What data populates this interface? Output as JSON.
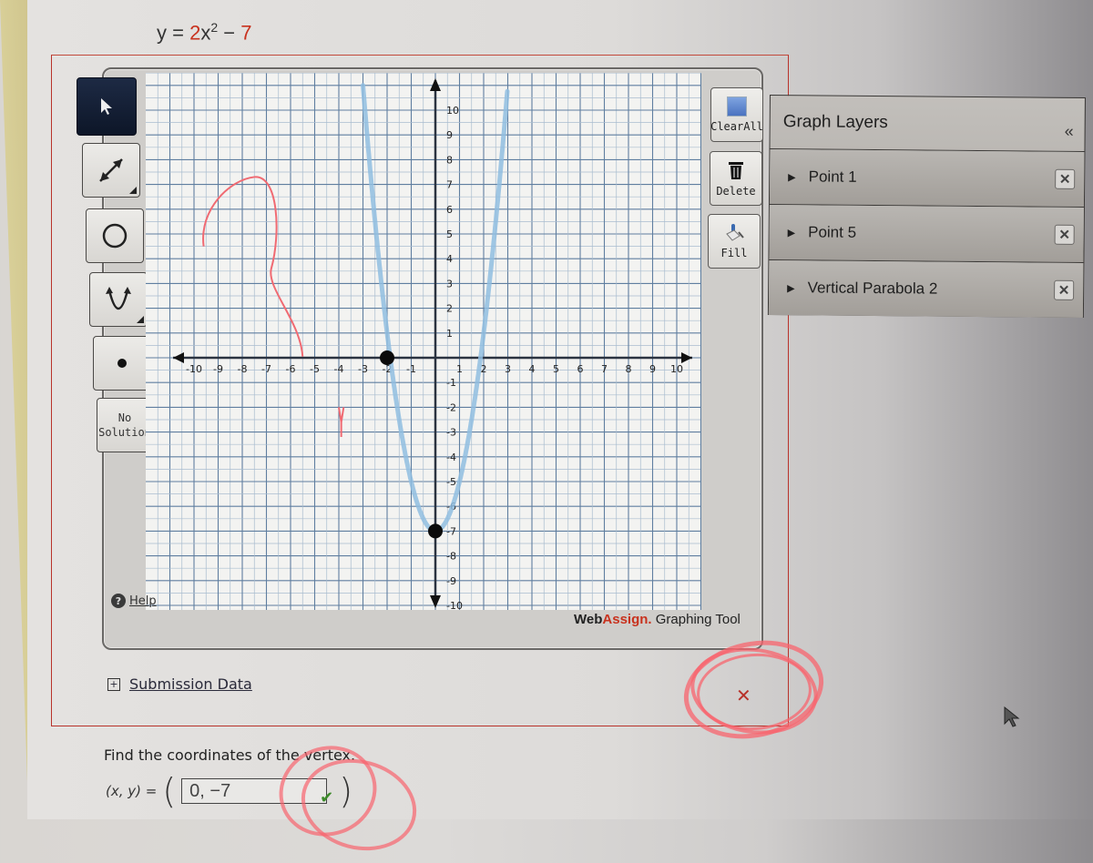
{
  "problem": {
    "equation_prefix": "y = ",
    "coefficient_a": "2",
    "variable": "x",
    "exponent": "2",
    "operator": " − ",
    "constant": "7"
  },
  "toolbar_left": [
    {
      "name": "select-tool",
      "icon": "arrow-pointer-icon",
      "selected": true
    },
    {
      "name": "line-tool",
      "icon": "double-arrow-line-icon",
      "has_submenu": true
    },
    {
      "name": "circle-tool",
      "icon": "circle-icon"
    },
    {
      "name": "parabola-tool",
      "icon": "parabola-icon",
      "has_submenu": true
    },
    {
      "name": "point-tool",
      "icon": "point-icon"
    },
    {
      "name": "no-solution-button",
      "label": "No\nSolution"
    }
  ],
  "toolbar_right": {
    "clear_all_label": "ClearAll",
    "delete_label": "Delete",
    "fill_label": "Fill"
  },
  "help_label": "Help",
  "branding": {
    "web": "Web",
    "assign": "Assign.",
    "suffix": " Graphing Tool"
  },
  "graph_layers": {
    "title": "Graph Layers",
    "collapse_icon": "«",
    "layers": [
      {
        "label": "Point 1"
      },
      {
        "label": "Point 5"
      },
      {
        "label": "Vertical Parabola 2"
      }
    ]
  },
  "submission_data_label": "Submission Data",
  "result_mark": "✕",
  "vertex_question": {
    "prompt": "Find the coordinates of the vertex.",
    "xy_label": "(x, y) =",
    "open_paren": "(",
    "close_paren": ")",
    "answer_value": "0, −7",
    "correct_mark": "✔"
  },
  "colors": {
    "accent_red": "#c8321e",
    "parabola_blue": "#8fbde0",
    "correct_green": "#3d8a2a",
    "annotation_pink": "#f8646e"
  },
  "chart_data": {
    "type": "line",
    "title": "",
    "xlabel": "",
    "ylabel": "",
    "xlim": [
      -10,
      10
    ],
    "ylim": [
      -10,
      10
    ],
    "x_ticks": [
      -10,
      -9,
      -8,
      -7,
      -6,
      -5,
      -4,
      -3,
      -2,
      -1,
      1,
      2,
      3,
      4,
      5,
      6,
      7,
      8,
      9,
      10
    ],
    "y_ticks": [
      10,
      9,
      8,
      7,
      6,
      5,
      4,
      3,
      2,
      1,
      -1,
      -2,
      -3,
      -4,
      -5,
      -6,
      -7,
      -8,
      -9,
      -10
    ],
    "grid": true,
    "series": [
      {
        "name": "Vertical Parabola 2",
        "kind": "parabola",
        "a": 2,
        "h": 0,
        "k": -7
      }
    ],
    "points": [
      {
        "name": "Point 1",
        "x": -2,
        "y": 0
      },
      {
        "name": "Point 5",
        "x": 0,
        "y": -7
      }
    ]
  }
}
